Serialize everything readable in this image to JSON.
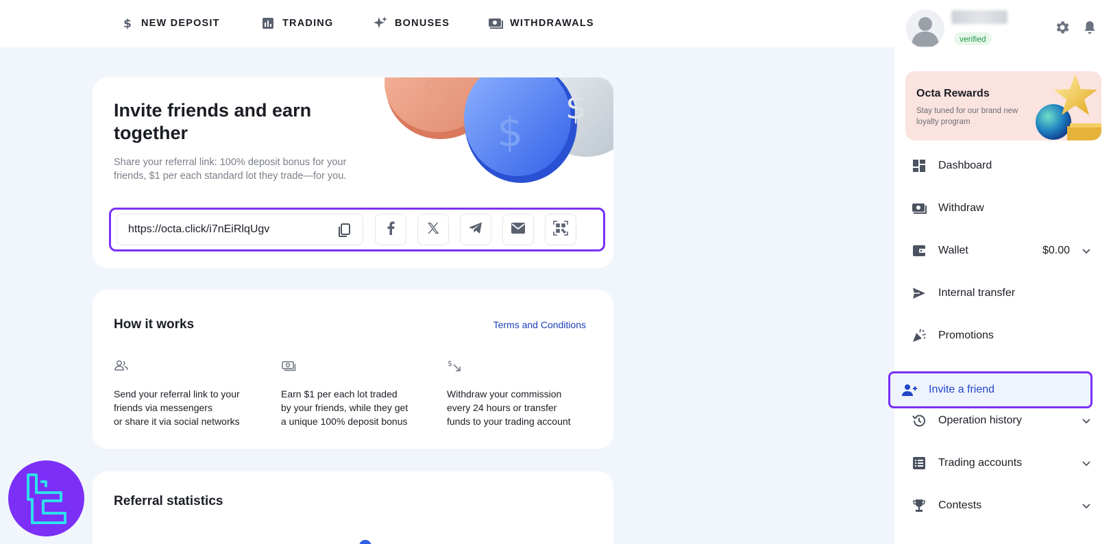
{
  "topnav": {
    "items": [
      {
        "label": "NEW DEPOSIT",
        "icon": "dollar-icon"
      },
      {
        "label": "TRADING",
        "icon": "chart-icon"
      },
      {
        "label": "BONUSES",
        "icon": "sparkle-icon"
      },
      {
        "label": "WITHDRAWALS",
        "icon": "cash-icon"
      }
    ]
  },
  "profile": {
    "verified_label": "verified"
  },
  "rewards": {
    "title": "Octa Rewards",
    "subtitle": "Stay tuned for our brand new loyalty program"
  },
  "sidebar": {
    "items": [
      {
        "label": "Dashboard",
        "icon": "dashboard-icon"
      },
      {
        "label": "Withdraw",
        "icon": "cash-icon"
      },
      {
        "label": "Wallet",
        "icon": "wallet-icon",
        "value": "$0.00"
      },
      {
        "label": "Internal transfer",
        "icon": "send-icon"
      },
      {
        "label": "Promotions",
        "icon": "party-icon"
      },
      {
        "label": "Invite a friend",
        "icon": "add-user-icon"
      },
      {
        "label": "Operation history",
        "icon": "history-icon"
      },
      {
        "label": "Trading accounts",
        "icon": "list-icon"
      },
      {
        "label": "Contests",
        "icon": "trophy-icon"
      }
    ],
    "active_item": "Invite a friend"
  },
  "invite": {
    "title": "Invite friends and earn together",
    "subtitle": "Share your referral link: 100% deposit bonus for your friends, $1 per each standard lot they trade—for you.",
    "referral_link": "https://octa.click/i7nEiRlqUgv",
    "share_buttons": [
      "facebook-icon",
      "x-icon",
      "telegram-icon",
      "email-icon",
      "qr-code-icon"
    ]
  },
  "how_it_works": {
    "title": "How it works",
    "terms_link": "Terms and Conditions",
    "steps": [
      {
        "icon": "users-icon",
        "text_lines": [
          "Send your referral link to your",
          "friends via messengers",
          "or share it via social networks"
        ]
      },
      {
        "icon": "cash-icon",
        "text_lines": [
          "Earn $1 per each lot traded",
          "by your friends, while they get",
          "a unique 100% deposit bonus"
        ]
      },
      {
        "icon": "exchange-icon",
        "text_lines": [
          "Withdraw your commission",
          "every 24 hours or transfer",
          "funds to your trading account"
        ]
      }
    ]
  },
  "referral_stats": {
    "title": "Referral statistics"
  },
  "colors": {
    "highlight": "#7b2ff7",
    "link": "#1d3fb8",
    "background": "#f1f5fc"
  }
}
